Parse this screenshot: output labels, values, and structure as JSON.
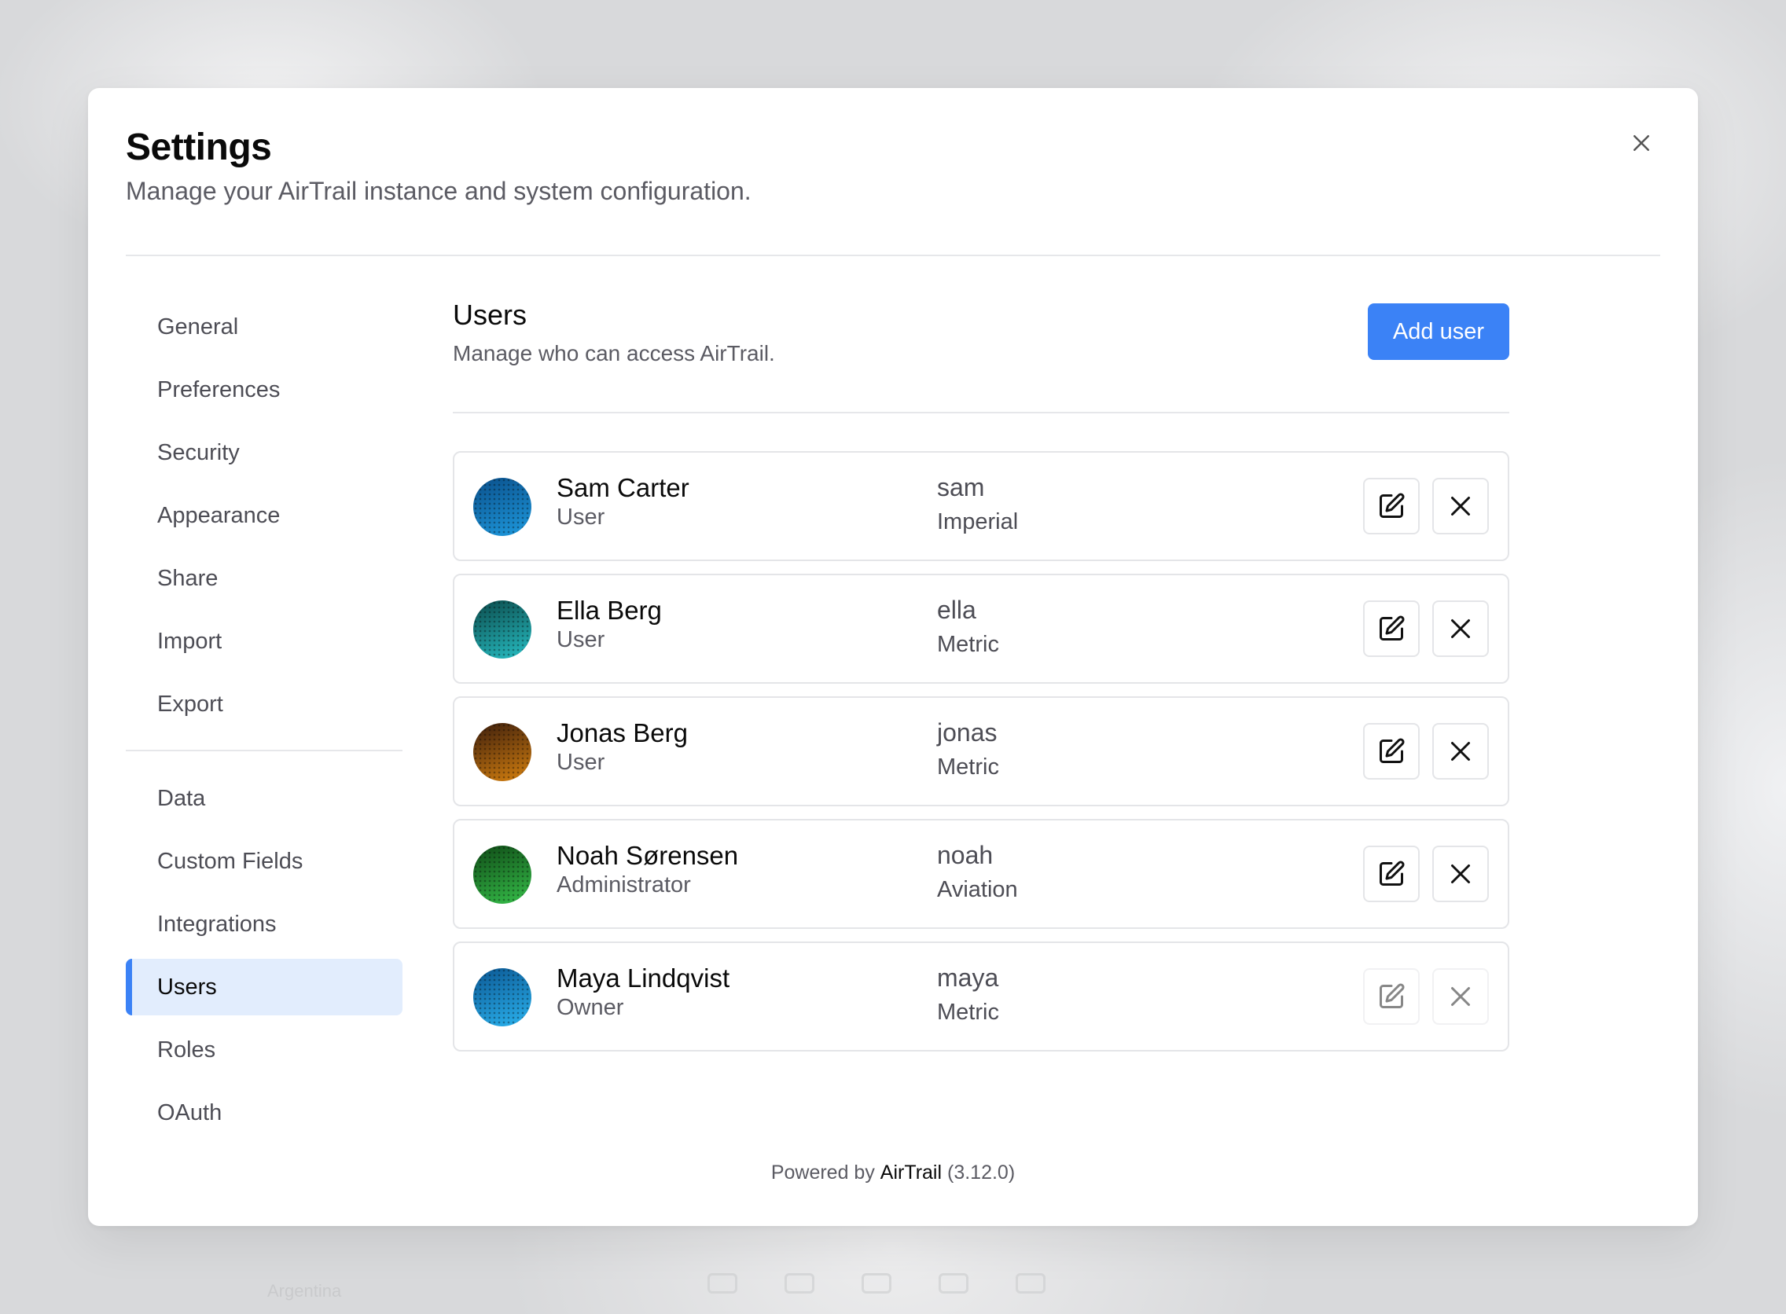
{
  "background": {
    "map_label": "Argentina"
  },
  "modal": {
    "title": "Settings",
    "subtitle": "Manage your AirTrail instance and system configuration."
  },
  "sidebar": {
    "group1": [
      {
        "label": "General"
      },
      {
        "label": "Preferences"
      },
      {
        "label": "Security"
      },
      {
        "label": "Appearance"
      },
      {
        "label": "Share"
      },
      {
        "label": "Import"
      },
      {
        "label": "Export"
      }
    ],
    "group2": [
      {
        "label": "Data"
      },
      {
        "label": "Custom Fields"
      },
      {
        "label": "Integrations"
      },
      {
        "label": "Users",
        "active": true
      },
      {
        "label": "Roles"
      },
      {
        "label": "OAuth"
      }
    ]
  },
  "content": {
    "title": "Users",
    "subtitle": "Manage who can access AirTrail.",
    "add_button": "Add user"
  },
  "users": [
    {
      "name": "Sam Carter",
      "role": "User",
      "username": "sam",
      "units": "Imperial",
      "avatar_colors": [
        "#0a4f8a",
        "#1e9be0"
      ],
      "actions_enabled": true
    },
    {
      "name": "Ella Berg",
      "role": "User",
      "username": "ella",
      "units": "Metric",
      "avatar_colors": [
        "#0b4a4a",
        "#27c0c6"
      ],
      "actions_enabled": true
    },
    {
      "name": "Jonas Berg",
      "role": "User",
      "username": "jonas",
      "units": "Metric",
      "avatar_colors": [
        "#3a1c0c",
        "#d8820f"
      ],
      "actions_enabled": true
    },
    {
      "name": "Noah Sørensen",
      "role": "Administrator",
      "username": "noah",
      "units": "Aviation",
      "avatar_colors": [
        "#0f4a16",
        "#36c04a"
      ],
      "actions_enabled": true
    },
    {
      "name": "Maya Lindqvist",
      "role": "Owner",
      "username": "maya",
      "units": "Metric",
      "avatar_colors": [
        "#0b5793",
        "#2bb4f0"
      ],
      "actions_enabled": false
    }
  ],
  "footer": {
    "prefix": "Powered by",
    "brand": "AirTrail",
    "version": "(3.12.0)"
  },
  "colors": {
    "accent": "#3b82f6",
    "active_nav_bg": "#e2edfd"
  }
}
